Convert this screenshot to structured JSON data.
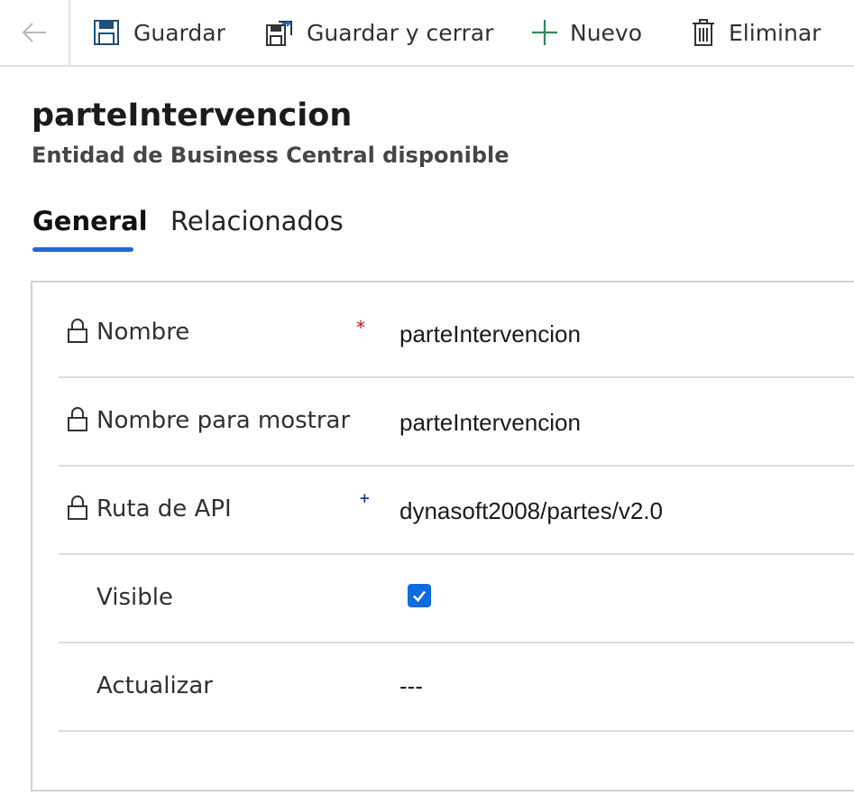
{
  "toolbar": {
    "back_icon": "back-arrow-icon",
    "save_label": "Guardar",
    "save_close_label": "Guardar y cerrar",
    "new_label": "Nuevo",
    "delete_label": "Eliminar"
  },
  "header": {
    "title": "parteIntervencion",
    "subtitle": "Entidad de Business Central disponible"
  },
  "tabs": [
    {
      "label": "General",
      "active": true
    },
    {
      "label": "Relacionados",
      "active": false
    }
  ],
  "fields": [
    {
      "label": "Nombre",
      "value": "parteIntervencion",
      "locked": true,
      "required": true
    },
    {
      "label": "Nombre para mostrar",
      "value": "parteIntervencion",
      "locked": true
    },
    {
      "label": "Ruta de API",
      "value": "dynasoft2008/partes/v2.0",
      "locked": true,
      "recommended": true
    },
    {
      "label": "Visible",
      "checked": true
    },
    {
      "label": "Actualizar",
      "value": "---"
    }
  ],
  "markers": {
    "required": "*",
    "recommended": "+"
  },
  "colors": {
    "accent": "#2266d8",
    "checkbox": "#0f6cde",
    "required": "#c50f1f",
    "new_icon": "#2e8b57"
  }
}
